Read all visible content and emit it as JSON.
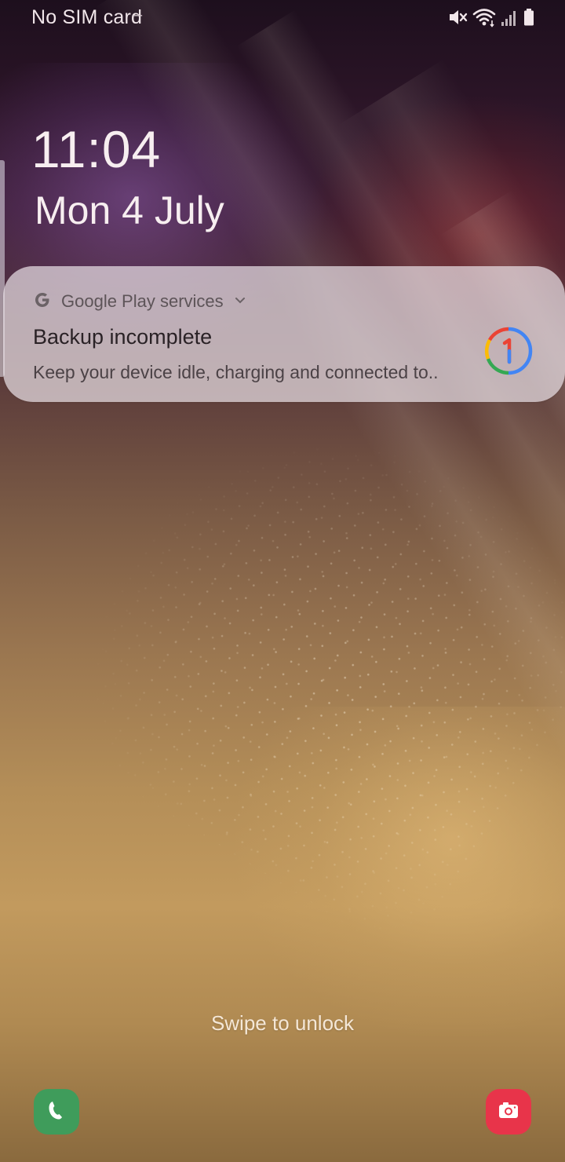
{
  "status_bar": {
    "carrier": "No SIM card",
    "icons": [
      "mute-icon",
      "wifi-icon",
      "signal-icon",
      "battery-icon"
    ]
  },
  "clock": {
    "time": "11:04",
    "date": "Mon 4 July"
  },
  "notification": {
    "app_icon": "google-g-icon",
    "app_name": "Google Play services",
    "title": "Backup incomplete",
    "text": "Keep your device idle, charging and connected to..",
    "large_icon": "google-one-icon"
  },
  "lock_screen": {
    "hint": "Swipe to unlock",
    "shortcuts": [
      {
        "name": "phone",
        "icon": "phone-icon",
        "color": "#3f9c5b"
      },
      {
        "name": "camera",
        "icon": "camera-icon",
        "color": "#e8344a"
      }
    ]
  },
  "colors": {
    "google_blue": "#4285F4",
    "google_red": "#EA4335",
    "google_yellow": "#FBBC05",
    "google_green": "#34A853"
  }
}
